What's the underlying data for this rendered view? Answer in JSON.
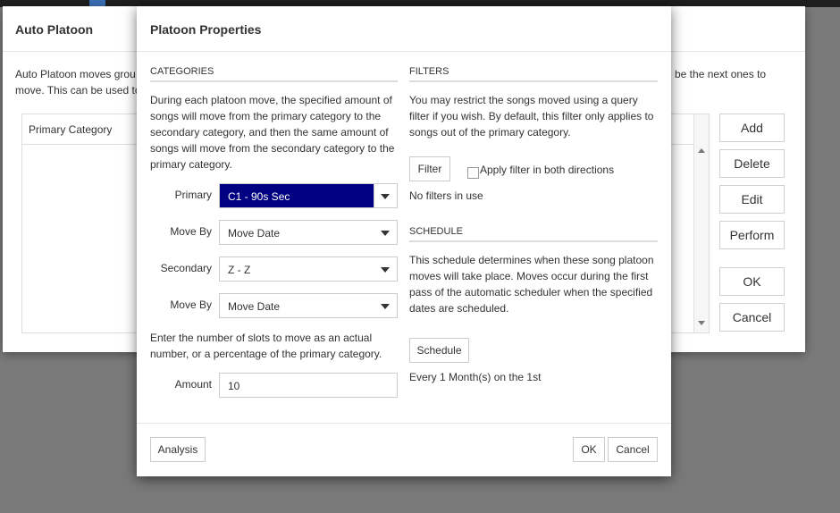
{
  "background_dialog": {
    "title": "Auto Platoon",
    "description_left": "Auto Platoon moves grou move. This can be used to",
    "description_right": "be the next ones to",
    "table": {
      "columns": [
        "Primary Category"
      ]
    },
    "buttons": {
      "add": "Add",
      "delete": "Delete",
      "edit": "Edit",
      "perform": "Perform",
      "ok": "OK",
      "cancel": "Cancel"
    }
  },
  "dialog": {
    "title": "Platoon Properties",
    "categories": {
      "heading": "CATEGORIES",
      "description": "During each platoon move, the specified amount of songs will move from the primary category to the secondary category, and then the same amount of songs will move from the secondary category to the primary category.",
      "primary_label": "Primary",
      "primary_value": "C1 - 90s Sec",
      "move_by_label": "Move By",
      "move_by_primary": "Move Date",
      "secondary_label": "Secondary",
      "secondary_value": "Z - Z",
      "move_by_label_2": "Move By",
      "move_by_secondary": "Move Date",
      "amount_help": "Enter the number of slots to move as an actual number, or a percentage of the primary category.",
      "amount_label": "Amount",
      "amount_value": "10"
    },
    "filters": {
      "heading": "FILTERS",
      "description": "You may restrict the songs moved using a query filter if you wish. By default, this filter only applies to songs out of the primary category.",
      "filter_button": "Filter",
      "apply_both_label": "Apply filter in both directions",
      "apply_both_checked": false,
      "status": "No filters in use"
    },
    "schedule": {
      "heading": "SCHEDULE",
      "description": "This schedule determines when these song platoon moves will take place. Moves occur during the first pass of the automatic scheduler when the specified dates are scheduled.",
      "schedule_button": "Schedule",
      "summary": "Every 1 Month(s) on the 1st"
    },
    "footer": {
      "analysis": "Analysis",
      "ok": "OK",
      "cancel": "Cancel"
    }
  },
  "colors": {
    "selection": "#000080",
    "overlay": "#7a7a7a"
  }
}
